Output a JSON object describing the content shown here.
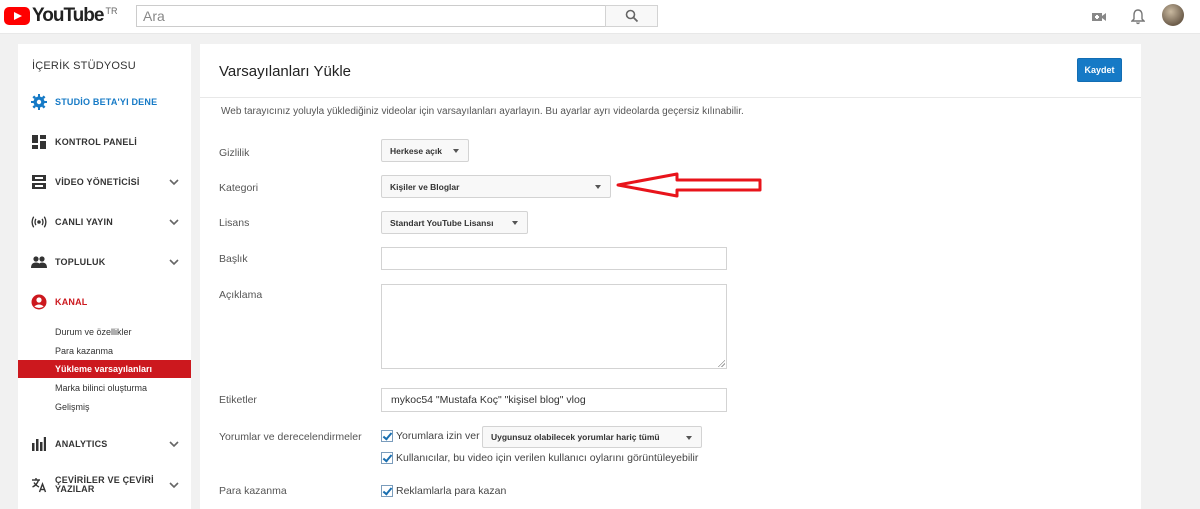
{
  "topbar": {
    "logo_text": "YouTube",
    "country_code": "TR",
    "search_placeholder": "Ara",
    "icons": [
      "search-icon",
      "video-camera-icon",
      "bell-icon",
      "avatar"
    ]
  },
  "sidebar": {
    "title": "İÇERİK STÜDYOSU",
    "items": [
      {
        "label": "STUDİO BETA'YI DENE",
        "icon": "gear-icon",
        "color": "#167ac6"
      },
      {
        "label": "KONTROL PANELİ",
        "icon": "dashboard-icon"
      },
      {
        "label": "VİDEO YÖNETİCİSİ",
        "icon": "video-manager-icon"
      },
      {
        "label": "CANLI YAYIN",
        "icon": "live-icon"
      },
      {
        "label": "TOPLULUK",
        "icon": "people-icon"
      },
      {
        "label": "KANAL",
        "icon": "channel-icon",
        "color": "#cc181e"
      },
      {
        "label": "ANALYTICS",
        "icon": "analytics-icon"
      },
      {
        "label_line1": "ÇEVİRİLER VE ÇEVİRİ",
        "label_line2": "YAZILAR",
        "icon": "translate-icon"
      }
    ],
    "subitems": [
      {
        "label": "Durum ve özellikler"
      },
      {
        "label": "Para kazanma"
      },
      {
        "label": "Yükleme varsayılanları",
        "active": true
      },
      {
        "label": "Marka bilinci oluşturma"
      },
      {
        "label": "Gelişmiş"
      }
    ]
  },
  "main": {
    "title": "Varsayılanları Yükle",
    "save_label": "Kaydet",
    "description": "Web tarayıcınız yoluyla yüklediğiniz videolar için varsayılanları ayarlayın. Bu ayarlar ayrı videolarda geçersiz kılınabilir.",
    "privacy": {
      "label": "Gizlilik",
      "value": "Herkese açık"
    },
    "category": {
      "label": "Kategori",
      "value": "Kişiler ve Bloglar"
    },
    "license": {
      "label": "Lisans",
      "value": "Standart YouTube Lisansı"
    },
    "title_field": {
      "label": "Başlık",
      "value": ""
    },
    "description_field": {
      "label": "Açıklama",
      "value": ""
    },
    "tags": {
      "label": "Etiketler",
      "value": "mykoc54 \"Mustafa Koç\" \"kişisel blog\" vlog"
    },
    "comments": {
      "label": "Yorumlar ve derecelendirmeler",
      "allow_label": "Yorumlara izin ver",
      "allow_checked": true,
      "filter_value": "Uygunsuz olabilecek yorumlar hariç tümü",
      "ratings_label": "Kullanıcılar, bu video için verilen kullanıcı oylarını görüntüleyebilir",
      "ratings_checked": true
    },
    "monetization": {
      "label": "Para kazanma",
      "ads_label": "Reklamlarla para kazan",
      "ads_checked": true
    }
  },
  "annotation": {
    "arrow_color": "#e8141b"
  },
  "colors": {
    "accent": "#167ac6",
    "brand_red": "#cc181e"
  }
}
